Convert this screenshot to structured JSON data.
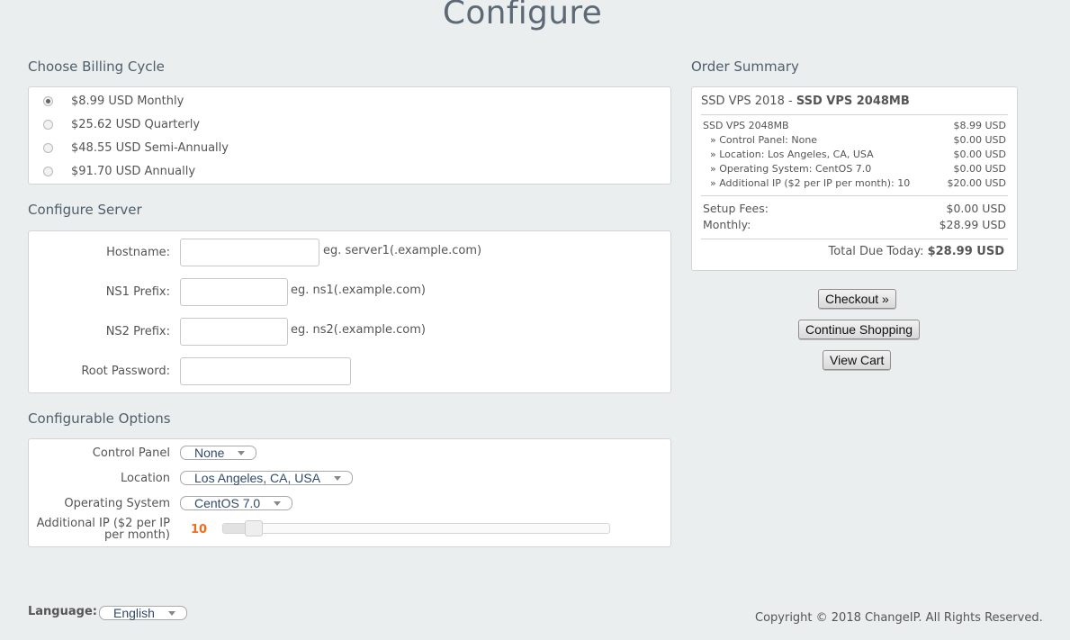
{
  "page": {
    "title": "Configure"
  },
  "billing": {
    "title": "Choose Billing Cycle",
    "options": [
      {
        "label": "$8.99 USD Monthly",
        "selected": true
      },
      {
        "label": "$25.62 USD Quarterly",
        "selected": false
      },
      {
        "label": "$48.55 USD Semi-Annually",
        "selected": false
      },
      {
        "label": "$91.70 USD Annually",
        "selected": false
      }
    ]
  },
  "server": {
    "title": "Configure Server",
    "hostname": {
      "label": "Hostname:",
      "value": "",
      "hint": "eg. server1(.example.com)"
    },
    "ns1": {
      "label": "NS1 Prefix:",
      "value": "",
      "hint": "eg. ns1(.example.com)"
    },
    "ns2": {
      "label": "NS2 Prefix:",
      "value": "",
      "hint": "eg. ns2(.example.com)"
    },
    "root_password": {
      "label": "Root Password:",
      "value": ""
    }
  },
  "options": {
    "title": "Configurable Options",
    "control_panel": {
      "label": "Control Panel",
      "selected": "None"
    },
    "location": {
      "label": "Location",
      "selected": "Los Angeles, CA, USA"
    },
    "os": {
      "label": "Operating System",
      "selected": "CentOS 7.0"
    },
    "additional_ip": {
      "label": "Additional IP ($2 per IP per month)",
      "value": "10",
      "fraction": 0.08
    }
  },
  "summary": {
    "title": "Order Summary",
    "product_group": "SSD VPS 2018 - ",
    "product_name": "SSD VPS 2048MB",
    "items": [
      {
        "label": "SSD VPS 2048MB",
        "price": "$8.99 USD"
      },
      {
        "label": "» Control Panel: None",
        "price": "$0.00 USD"
      },
      {
        "label": "» Location: Los Angeles, CA, USA",
        "price": "$0.00 USD"
      },
      {
        "label": "» Operating System: CentOS 7.0",
        "price": "$0.00 USD"
      },
      {
        "label": "» Additional IP ($2 per IP per month): 10",
        "price": "$20.00 USD"
      }
    ],
    "setup_label": "Setup Fees:",
    "setup_value": "$0.00 USD",
    "monthly_label": "Monthly:",
    "monthly_value": "$28.99 USD",
    "total_label": "Total Due Today:",
    "total_value": "$28.99 USD"
  },
  "actions": {
    "checkout": "Checkout »",
    "continue": "Continue Shopping",
    "view_cart": "View Cart"
  },
  "footer": {
    "language_label": "Language:",
    "language_value": "English",
    "copyright": "Copyright © 2018 ChangeIP. All Rights Reserved."
  }
}
